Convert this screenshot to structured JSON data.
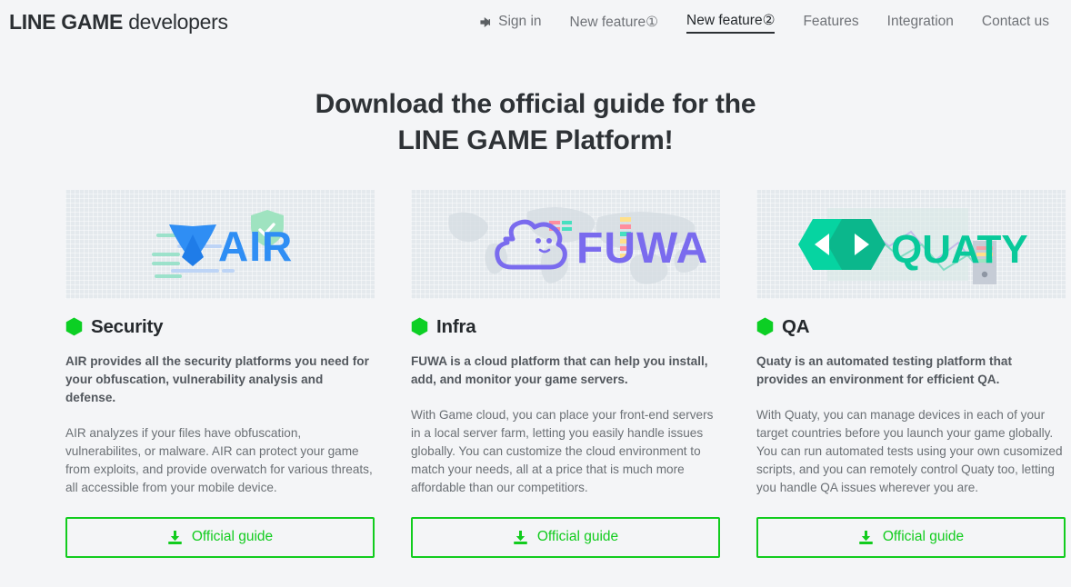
{
  "header": {
    "brand_strong": "LINE GAME",
    "brand_light": "developers",
    "nav": [
      {
        "label": "Sign in",
        "icon": "sign-in-icon",
        "active": false
      },
      {
        "label": "New feature①",
        "active": false
      },
      {
        "label": "New feature②",
        "active": true
      },
      {
        "label": "Features",
        "active": false
      },
      {
        "label": "Integration",
        "active": false
      },
      {
        "label": "Contact us",
        "active": false
      }
    ]
  },
  "hero": {
    "title_line1": "Download the official guide for the",
    "title_line2": "LINE GAME Platform!"
  },
  "cards": [
    {
      "logo_name": "air-logo",
      "logo_text": "AIR",
      "title": "Security",
      "lead": "AIR provides all the security platforms you need for your obfuscation, vulnerability analysis and defense.",
      "body": "AIR analyzes if your files have obfuscation, vulnerabilites, or malware. AIR can protect your game from exploits, and provide overwatch for various threats, all accessible from your mobile device.",
      "button_label": "Official guide"
    },
    {
      "logo_name": "fuwa-logo",
      "logo_text": "FUWA",
      "title": "Infra",
      "lead": "FUWA is a cloud platform that can help you install, add, and monitor your game servers.",
      "body": "With Game cloud, you can place your front-end servers in a local server farm, letting you easily handle issues globally. You can customize the cloud environment to match your needs, all at a price that is much more affordable than our competitiors.",
      "button_label": "Official guide"
    },
    {
      "logo_name": "quaty-logo",
      "logo_text": "QUATY",
      "title": "QA",
      "lead": "Quaty is an automated testing platform that provides an environment for efficient QA.",
      "body": "With Quaty, you can manage devices in each of your target countries before you launch your game globally. You can run automated tests using your own cusomized scripts, and you can remotely control Quaty too, letting you handle QA issues wherever you are.",
      "button_label": "Official guide"
    }
  ],
  "colors": {
    "page_background": "#f4f5f7",
    "media_background": "#e4e9ed",
    "accent_green": "#12cc1e",
    "hex_green": "#0ccf24",
    "air_blue": "#2f8ef4",
    "fuwa_purple": "#7a6bee",
    "quaty_teal": "#08c99a",
    "heading_dark": "#2e3236",
    "nav_gray": "#6f7277"
  }
}
